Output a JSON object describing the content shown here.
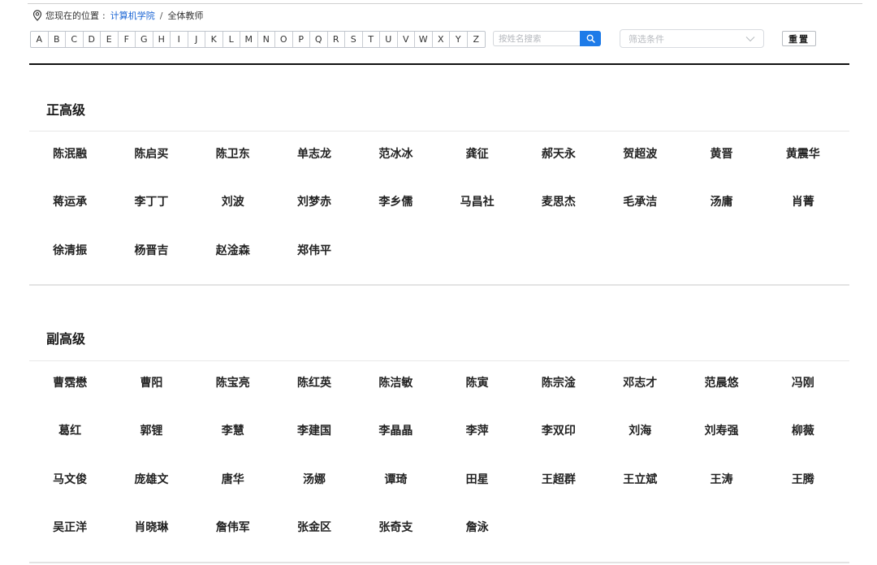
{
  "breadcrumb": {
    "prefix": "您现在的位置",
    "colon": ":",
    "link": "计算机学院",
    "separator": "/",
    "current": "全体教师"
  },
  "letters": [
    "A",
    "B",
    "C",
    "D",
    "E",
    "F",
    "G",
    "H",
    "I",
    "J",
    "K",
    "L",
    "M",
    "N",
    "O",
    "P",
    "Q",
    "R",
    "S",
    "T",
    "U",
    "V",
    "W",
    "X",
    "Y",
    "Z"
  ],
  "search": {
    "placeholder": "按姓名搜索",
    "icon": "search-icon"
  },
  "filter": {
    "placeholder": "筛选条件",
    "icon": "chevron-down-icon"
  },
  "reset_label": "重置",
  "sections": [
    {
      "title": "正高级",
      "names": [
        "陈泯融",
        "陈启买",
        "陈卫东",
        "单志龙",
        "范冰冰",
        "龚征",
        "郝天永",
        "贺超波",
        "黄晋",
        "黄震华",
        "蒋运承",
        "李丁丁",
        "刘波",
        "刘梦赤",
        "李乡儒",
        "马昌社",
        "麦思杰",
        "毛承洁",
        "汤庸",
        "肖菁",
        "徐清振",
        "杨晋吉",
        "赵淦森",
        "郑伟平"
      ]
    },
    {
      "title": "副高级",
      "names": [
        "曹霑懋",
        "曹阳",
        "陈宝亮",
        "陈红英",
        "陈洁敏",
        "陈寅",
        "陈宗淦",
        "邓志才",
        "范晨悠",
        "冯刚",
        "葛红",
        "郭锂",
        "李慧",
        "李建国",
        "李晶晶",
        "李萍",
        "李双印",
        "刘海",
        "刘寿强",
        "柳薇",
        "马文俊",
        "庞雄文",
        "唐华",
        "汤娜",
        "谭琦",
        "田星",
        "王超群",
        "王立斌",
        "王涛",
        "王腾",
        "吴正洋",
        "肖晓琳",
        "詹伟军",
        "张金区",
        "张奇支",
        "詹泳"
      ]
    }
  ],
  "colors": {
    "link": "#1a64d4",
    "accent": "#1e7be8"
  }
}
